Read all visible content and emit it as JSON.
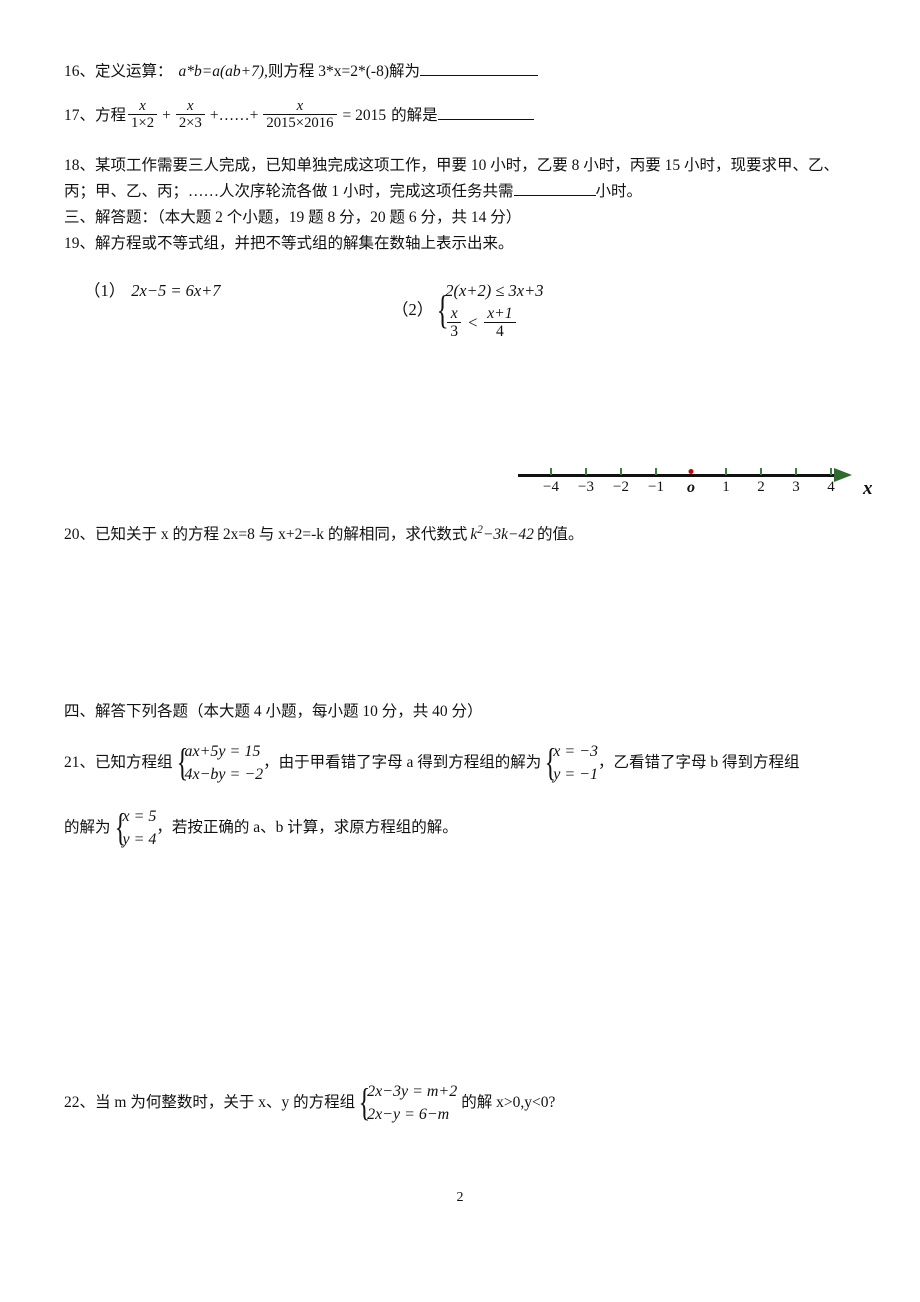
{
  "document": {
    "page_number": "2",
    "language": "zh-CN"
  },
  "q16": {
    "number": "16、",
    "label": "定义运算：",
    "definition": "a*b=a(ab+7),",
    "middle": "则方程 3*x=2*(-8)解为"
  },
  "q17": {
    "number": "17、",
    "label": "方程",
    "frac1_num": "x",
    "frac1_den": "1×2",
    "op1": "+",
    "frac2_num": "x",
    "frac2_den": "2×3",
    "op2": "+……+",
    "frac3_num": "x",
    "frac3_den": "2015×2016",
    "equals": "= 2015",
    "tail": "的解是"
  },
  "q18": {
    "number": "18、",
    "line1": "某项工作需要三人完成，已知单独完成这项工作，甲要 10 小时，乙要 8 小时，丙要 15 小时，现要求甲、乙、",
    "line2_a": "丙；甲、乙、丙；……人次序轮流各做 1 小时，完成这项任务共需",
    "line2_b": "小时。"
  },
  "section3": {
    "heading": "三、解答题：（本大题 2 个小题，19 题 8 分，20 题 6 分，共 14 分）"
  },
  "q19": {
    "number": "19、",
    "prompt": "解方程或不等式组，并把不等式组的解集在数轴上表示出来。",
    "part1_label": "（1）",
    "part1_eq": "2x−5 = 6x+7",
    "part2_label": "（2）",
    "part2_row1": "2(x+2) ≤ 3x+3",
    "part2_row2_left_num": "x",
    "part2_row2_left_den": "3",
    "part2_row2_rel": "<",
    "part2_row2_right_num": "x+1",
    "part2_row2_right_den": "4"
  },
  "number_line": {
    "ticks": [
      "−4",
      "−3",
      "−2",
      "−1",
      "1",
      "2",
      "3",
      "4"
    ],
    "origin_label": "o",
    "axis_label": "x",
    "tick_color": "#3f7a3f",
    "origin_dot_color": "#cc0000",
    "arrow_color": "#2f6b2f"
  },
  "q20": {
    "number": "20、",
    "text_a": "已知关于 x 的方程 2x=8 与 x+2=-k 的解相同，求代数式",
    "expr_base": "k",
    "expr_exp": "2",
    "expr_rest": "−3k−42",
    "text_b": "的值。"
  },
  "section4": {
    "heading": "四、解答下列各题（本大题 4 小题，每小题 10 分，共 40 分）"
  },
  "q21": {
    "number": "21、",
    "text_a": "已知方程组",
    "sys1_row1": "ax+5y = 15",
    "sys1_row2": "4x−by = −2",
    "text_b": "，由于甲看错了字母 a 得到方程组的解为",
    "sys2_row1": "x = −3",
    "sys2_row2": "y = −1",
    "text_c": "，乙看错了字母 b 得到方程组",
    "text_d": "的解为",
    "sys3_row1": "x = 5",
    "sys3_row2": "y = 4",
    "text_e": "，若按正确的 a、b 计算，求原方程组的解。"
  },
  "q22": {
    "number": "22、",
    "text_a": "当 m 为何整数时，关于 x、y 的方程组",
    "sys_row1": "2x−3y = m+2",
    "sys_row2": "2x−y = 6−m",
    "text_b": "的解 x>0,y<0?"
  }
}
